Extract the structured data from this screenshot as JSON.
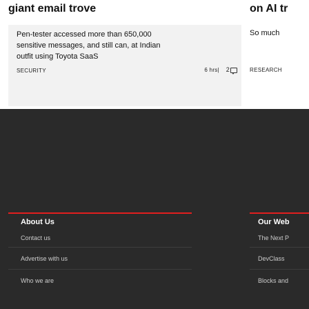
{
  "section": {
    "title": "giant email trove"
  },
  "story": {
    "lines": [
      "Pen-tester accessed more than 650,000",
      "sensitive messages, and still can, at Indian",
      "outfit using Toyota SaaS"
    ],
    "tag": "SECURITY",
    "time": "6 hrs",
    "separator": "|",
    "comments": "2"
  },
  "right_story": {
    "title": "on AI tr",
    "text": "So much",
    "tag": "RESEARCH"
  },
  "footer": {
    "left": {
      "heading": "About Us",
      "links": [
        "Contact us",
        "Advertise with us",
        "Who we are"
      ]
    },
    "right": {
      "heading": "Our Web",
      "links": [
        "The Next P",
        "DevClass",
        "Blocks and"
      ]
    },
    "accent_color": "#e21e1e"
  }
}
